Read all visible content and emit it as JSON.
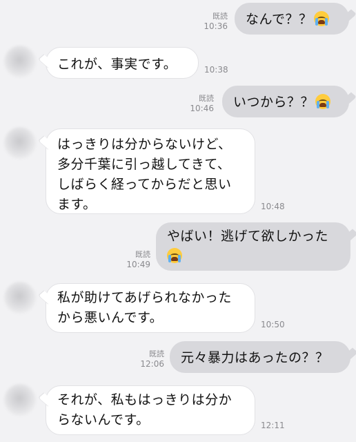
{
  "messages": [
    {
      "side": "out",
      "lines": [
        "なんで？？"
      ],
      "emoji": "loudly-crying-face",
      "read": "既読",
      "time": "10:36"
    },
    {
      "side": "in",
      "lines": [
        "これが、事実です。"
      ],
      "time": "10:38"
    },
    {
      "side": "out",
      "lines": [
        "いつから？？"
      ],
      "emoji": "loudly-crying-face",
      "read": "既読",
      "time": "10:46"
    },
    {
      "side": "in",
      "lines": [
        "はっきりは分からないけど、",
        "多分千葉に引っ越してきて、",
        "しばらく経ってからだと思い",
        "ます。"
      ],
      "time": "10:48"
    },
    {
      "side": "out",
      "lines": [
        "やばい！逃げて欲しかった"
      ],
      "emoji": "loudly-crying-face",
      "read": "既読",
      "time": "10:49"
    },
    {
      "side": "in",
      "lines": [
        "私が助けてあげられなかった",
        "から悪いんです。"
      ],
      "time": "10:50"
    },
    {
      "side": "out",
      "lines": [
        "元々暴力はあったの？？"
      ],
      "read": "既読",
      "time": "12:06"
    },
    {
      "side": "in",
      "lines": [
        "それが、私もはっきりは分か",
        "らないんです。"
      ],
      "time": "12:11"
    }
  ]
}
